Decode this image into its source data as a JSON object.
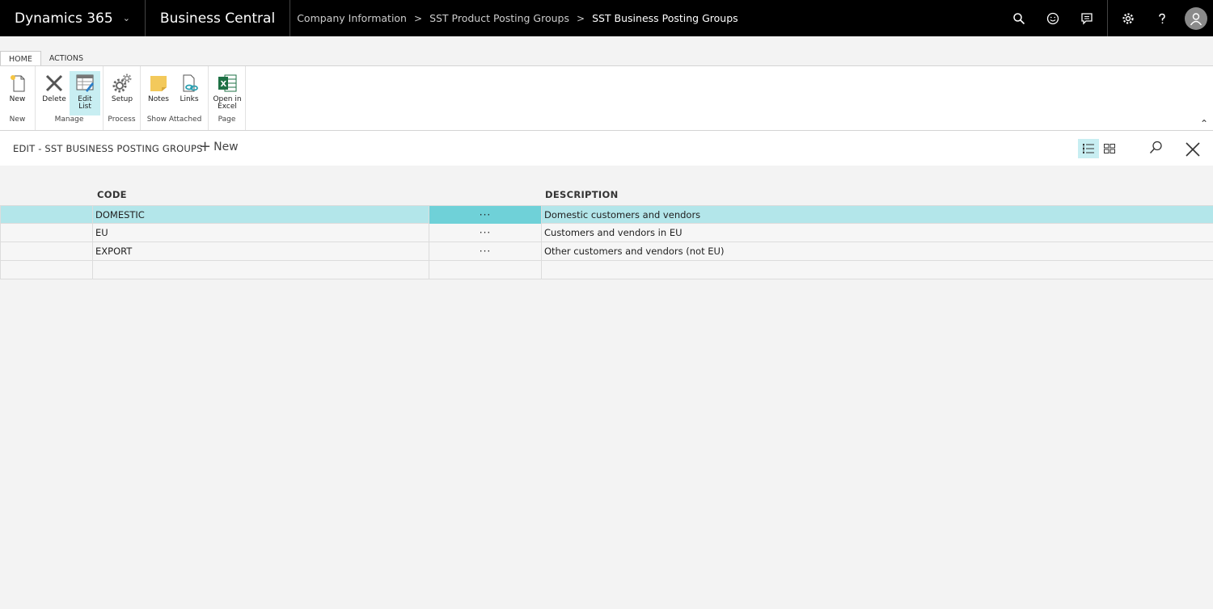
{
  "topbar": {
    "product": "Dynamics 365",
    "app": "Business Central",
    "breadcrumbs": [
      "Company Information",
      "SST Product Posting Groups"
    ],
    "current": "SST Business Posting Groups"
  },
  "ribbon": {
    "tabs": [
      "HOME",
      "ACTIONS"
    ],
    "groups": {
      "new": {
        "label": "New",
        "new_btn": "New"
      },
      "manage": {
        "label": "Manage",
        "delete_btn": "Delete",
        "edit_list_l1": "Edit",
        "edit_list_l2": "List"
      },
      "process": {
        "label": "Process",
        "setup_btn": "Setup"
      },
      "attached": {
        "label": "Show Attached",
        "notes_btn": "Notes",
        "links_btn": "Links"
      },
      "page": {
        "label": "Page",
        "excel_l1": "Open in",
        "excel_l2": "Excel"
      }
    }
  },
  "page": {
    "title": "EDIT - SST BUSINESS POSTING GROUPS",
    "new_label": "New"
  },
  "grid": {
    "columns": {
      "code": "CODE",
      "description": "DESCRIPTION"
    },
    "rows": [
      {
        "code": "DOMESTIC",
        "menu": "···",
        "description": "Domestic customers and vendors"
      },
      {
        "code": "EU",
        "menu": "···",
        "description": "Customers and vendors in EU"
      },
      {
        "code": "EXPORT",
        "menu": "···",
        "description": "Other customers and vendors (not EU)"
      }
    ]
  },
  "colors": {
    "selected_row": "#b3e6ea",
    "selected_cell": "#6fd1d8",
    "active_button": "#c8eef2"
  }
}
